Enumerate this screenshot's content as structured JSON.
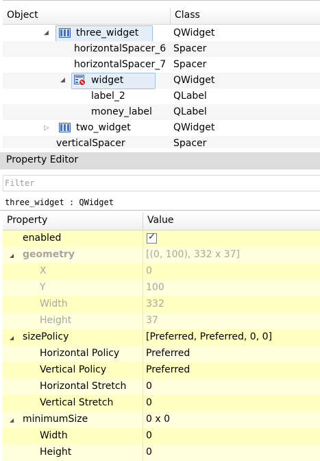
{
  "object_inspector": {
    "columns": [
      "Object",
      "Class"
    ],
    "rows": [
      {
        "name": "three_widget",
        "class": "QWidget",
        "indent": 1,
        "expander": "expanded",
        "icon": "layout-icon",
        "selected": true
      },
      {
        "name": "horizontalSpacer_6",
        "class": "Spacer",
        "indent": 2
      },
      {
        "name": "horizontalSpacer_7",
        "class": "Spacer",
        "indent": 2
      },
      {
        "name": "widget",
        "class": "QWidget",
        "indent": 2,
        "expander": "expanded",
        "icon": "broken-layout-icon",
        "highlight": true
      },
      {
        "name": "label_2",
        "class": "QLabel",
        "indent": 3
      },
      {
        "name": "money_label",
        "class": "QLabel",
        "indent": 3
      },
      {
        "name": "two_widget",
        "class": "QWidget",
        "indent": 1,
        "expander": "collapsed",
        "icon": "layout-icon"
      },
      {
        "name": "verticalSpacer",
        "class": "Spacer",
        "indent": 0
      }
    ]
  },
  "property_editor": {
    "title": "Property Editor",
    "filter_placeholder": "Filter",
    "object_line": "three_widget : QWidget",
    "columns": [
      "Property",
      "Value"
    ],
    "rows": [
      {
        "name": "enabled",
        "value": "",
        "level": 0,
        "checkbox": true,
        "checked": true
      },
      {
        "name": "geometry",
        "value": "[(0, 100), 332 x 37]",
        "level": 0,
        "group": true,
        "disabled": true,
        "bold": true
      },
      {
        "name": "X",
        "value": "0",
        "level": 1,
        "disabled": true
      },
      {
        "name": "Y",
        "value": "100",
        "level": 1,
        "disabled": true
      },
      {
        "name": "Width",
        "value": "332",
        "level": 1,
        "disabled": true
      },
      {
        "name": "Height",
        "value": "37",
        "level": 1,
        "disabled": true
      },
      {
        "name": "sizePolicy",
        "value": "[Preferred, Preferred, 0, 0]",
        "level": 0,
        "group": true
      },
      {
        "name": "Horizontal Policy",
        "value": "Preferred",
        "level": 1
      },
      {
        "name": "Vertical Policy",
        "value": "Preferred",
        "level": 1
      },
      {
        "name": "Horizontal Stretch",
        "value": "0",
        "level": 1
      },
      {
        "name": "Vertical Stretch",
        "value": "0",
        "level": 1
      },
      {
        "name": "minimumSize",
        "value": "0 x 0",
        "level": 0,
        "group": true
      },
      {
        "name": "Width",
        "value": "0",
        "level": 1
      },
      {
        "name": "Height",
        "value": "0",
        "level": 1
      }
    ]
  }
}
